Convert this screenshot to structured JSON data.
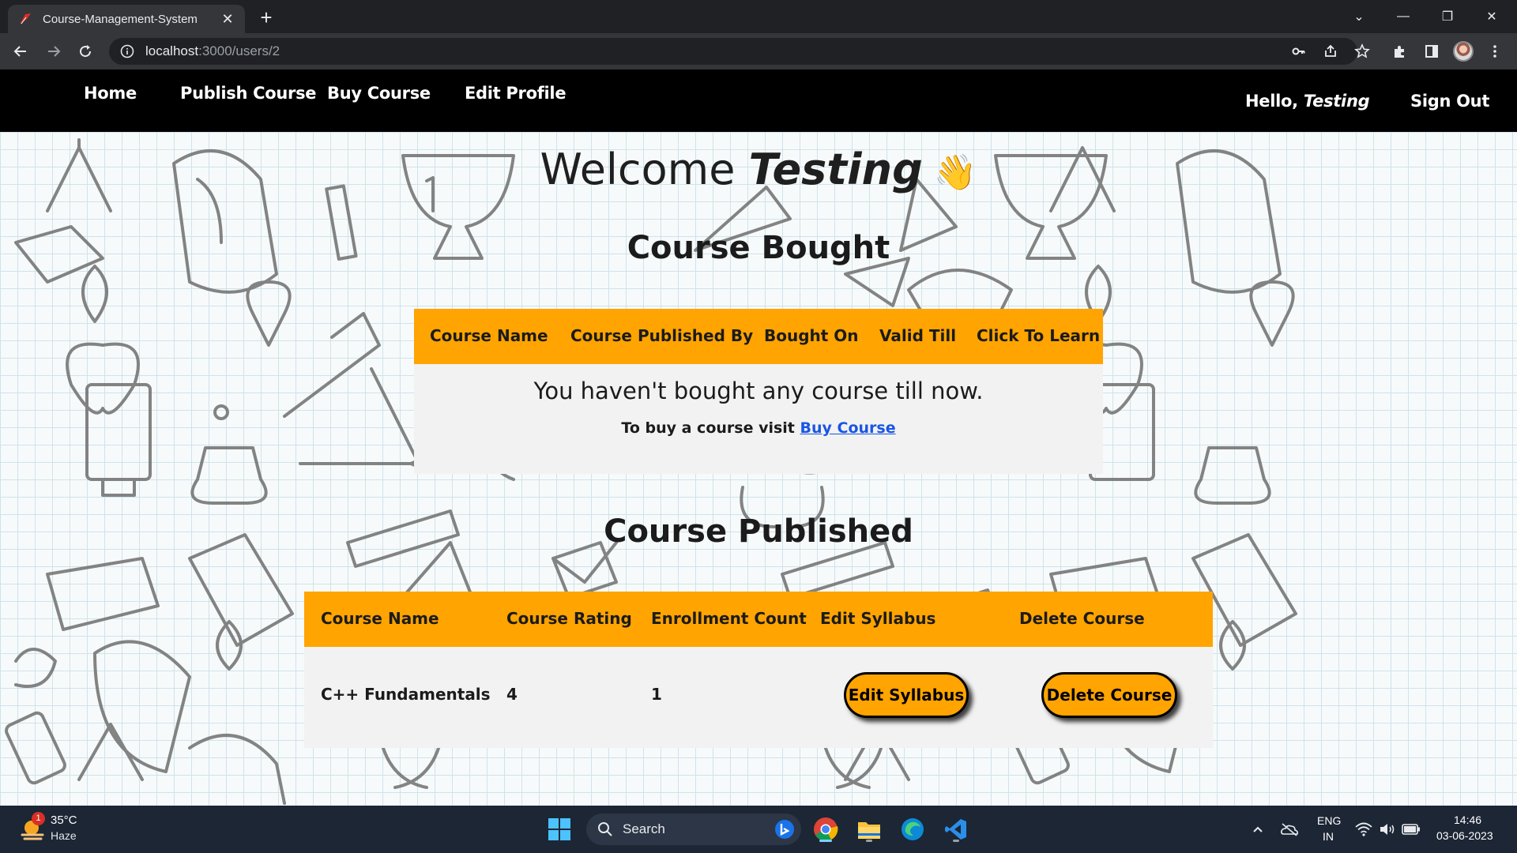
{
  "browser": {
    "tab_title": "Course-Management-System",
    "tab_close": "✕",
    "new_tab": "+",
    "url_host": "localhost",
    "url_path": ":3000/users/2",
    "window_controls": [
      "⌄",
      "—",
      "❐",
      "✕"
    ]
  },
  "site_nav": {
    "links": [
      "Home",
      "Publish Course",
      "Buy Course",
      "Edit Profile"
    ],
    "greeting": "Hello, ",
    "username": "Testing",
    "sign_out": "Sign Out"
  },
  "welcome": {
    "prefix": "Welcome ",
    "name": "Testing",
    "emoji": "👋"
  },
  "bought": {
    "title": "Course Bought",
    "headers": [
      "Course Name",
      "Course Published By",
      "Bought On",
      "Valid Till",
      "Click To Learn"
    ],
    "empty_message": "You haven't bought any course till now.",
    "visit_prefix": "To buy a course visit ",
    "visit_link": "Buy Course"
  },
  "published": {
    "title": "Course Published",
    "headers": [
      "Course Name",
      "Course Rating",
      "Enrollment Count",
      "Edit Syllabus",
      "Delete Course"
    ],
    "rows": [
      {
        "name": "C++ Fundamentals",
        "rating": "4",
        "enrollment": "1",
        "edit_label": "Edit Syllabus",
        "delete_label": "Delete Course"
      }
    ]
  },
  "taskbar": {
    "weather_temp": "35°C",
    "weather_desc": "Haze",
    "weather_badge": "1",
    "search_label": "Search",
    "language_1": "ENG",
    "language_2": "IN",
    "time": "14:46",
    "date": "03-06-2023"
  },
  "colors": {
    "accent": "#ffa400",
    "nav_bg": "#000000",
    "link": "#1a55e3",
    "taskbar_bg": "#1c2635"
  }
}
